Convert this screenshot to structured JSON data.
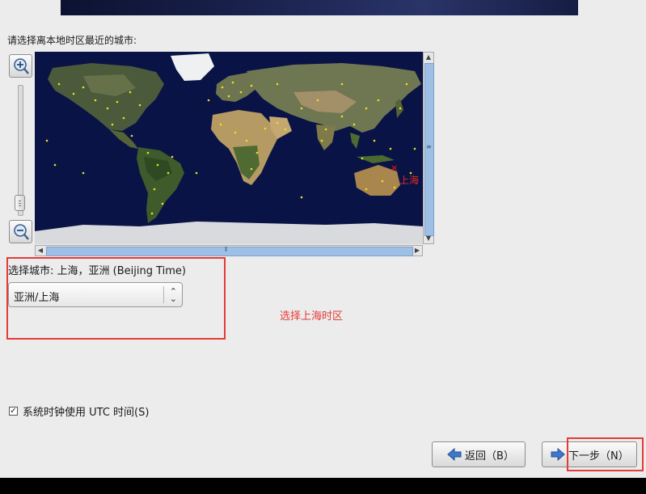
{
  "prompt": "请选择离本地时区最近的城市:",
  "map": {
    "selected_city_label": "上海",
    "selected_marker": "×",
    "zoom_in_icon": "zoom-in-icon",
    "zoom_out_icon": "zoom-out-icon"
  },
  "selection": {
    "label": "选择城市: 上海，亚洲 (Beijing Time)",
    "value": "亚洲/上海"
  },
  "annotation": {
    "text": "选择上海时区",
    "color": "#e53b36"
  },
  "utc": {
    "label": "系统时钟使用 UTC 时间(S)",
    "checked": true,
    "check_mark": "✓"
  },
  "buttons": {
    "back": "返回（B）",
    "next": "下一步（N）"
  }
}
